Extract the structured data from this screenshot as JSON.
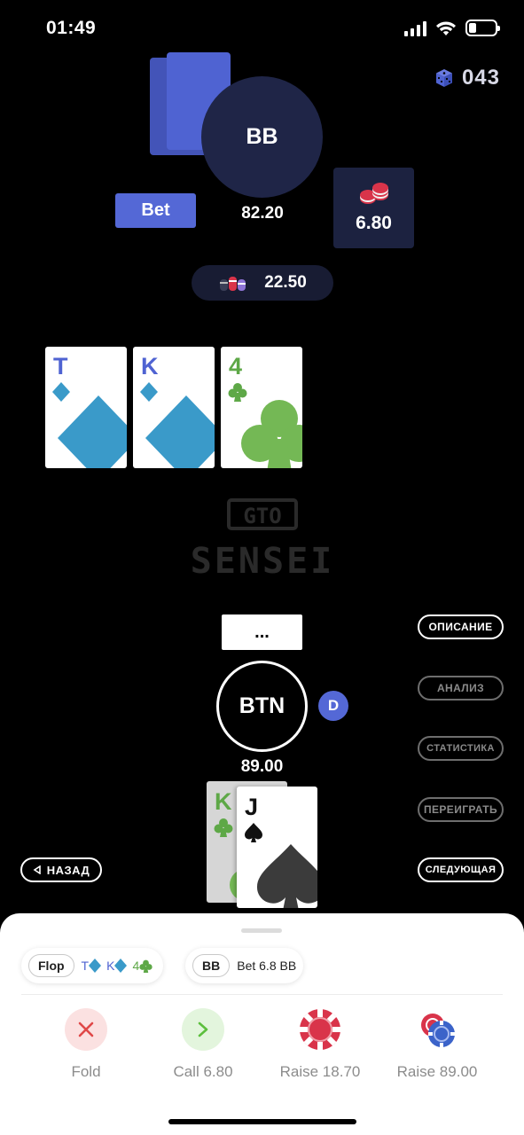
{
  "status_bar": {
    "time": "01:49"
  },
  "hand_counter": {
    "number": "043",
    "icon": "dice-icon",
    "color": "#4f63d2"
  },
  "villain": {
    "position": "BB",
    "stack": "82.20",
    "action_tag": "Bet",
    "bet_amount": "6.80",
    "card_back_color": "#4f63d2"
  },
  "pot": {
    "amount": "22.50"
  },
  "board": [
    {
      "rank": "T",
      "suit": "diamonds",
      "color": "#3a9ac9"
    },
    {
      "rank": "K",
      "suit": "diamonds",
      "color": "#3a9ac9"
    },
    {
      "rank": "4",
      "suit": "clubs",
      "color": "#5ea847"
    }
  ],
  "logo": {
    "line1": "GTO",
    "line2": "SENSEI"
  },
  "hero": {
    "position": "BTN",
    "dealer_label": "D",
    "stack": "89.00",
    "action_box": "...",
    "cards": [
      {
        "rank": "K",
        "suit": "clubs",
        "color": "#5ea847"
      },
      {
        "rank": "J",
        "suit": "spades",
        "color": "#111111"
      }
    ]
  },
  "side_buttons": {
    "description": "ОПИСАНИЕ",
    "analysis": "АНАЛИЗ",
    "statistics": "СТАТИСТИКА",
    "replay": "ПЕРЕИГРАТЬ",
    "next": "СЛЕДУЮЩАЯ",
    "back": "НАЗАД"
  },
  "sheet": {
    "street_chip": {
      "label": "Flop",
      "cards": [
        "T",
        "K",
        "4"
      ]
    },
    "action_chip": {
      "label": "BB",
      "text": "Bet 6.8 BB"
    },
    "actions": [
      {
        "label": "Fold",
        "icon": "x-icon",
        "bg": "#fbe1e1",
        "color": "#e04848"
      },
      {
        "label": "Call 6.80",
        "icon": "chevron-right-icon",
        "bg": "#e3f5dd",
        "color": "#5cbf3d"
      },
      {
        "label": "Raise 18.70",
        "icon": "chip-red-icon",
        "color": "#d9344a"
      },
      {
        "label": "Raise 89.00",
        "icon": "chip-stack-icon",
        "color": "#3b63c9"
      }
    ]
  }
}
